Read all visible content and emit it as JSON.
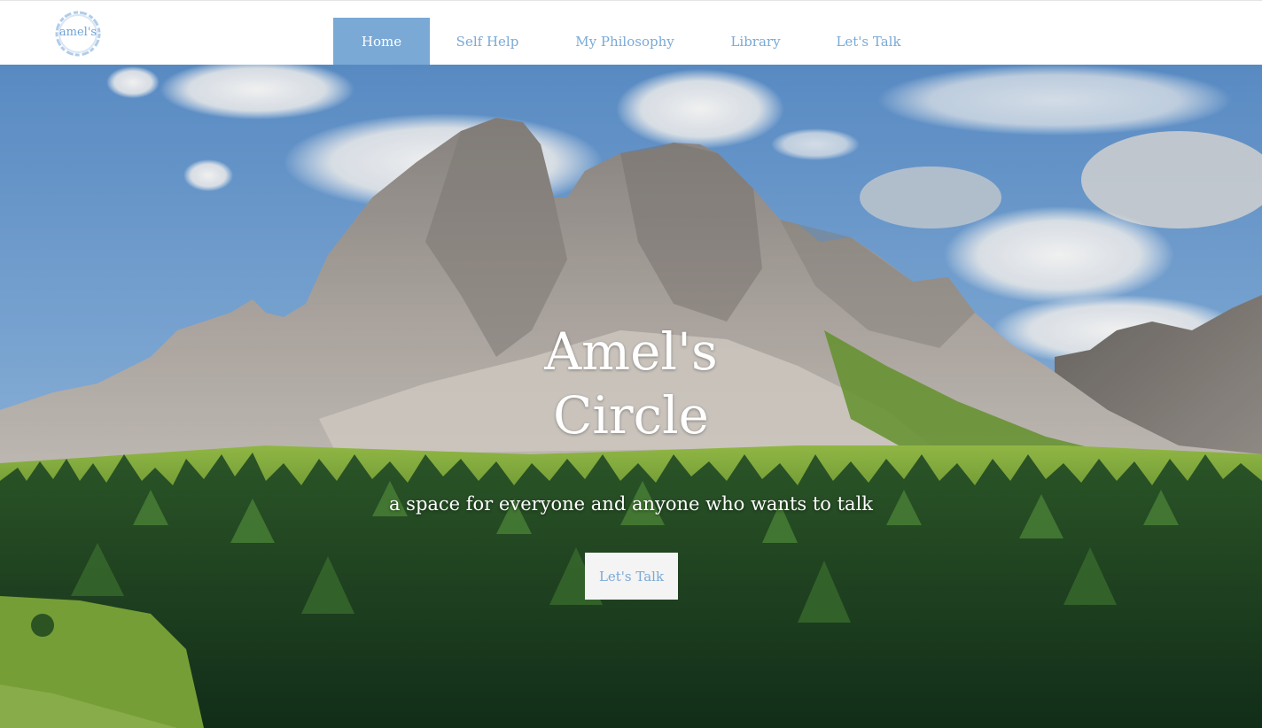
{
  "site": {
    "logo_text": "amel's"
  },
  "nav": {
    "items": [
      {
        "label": "Home",
        "active": true
      },
      {
        "label": "Self Help",
        "active": false
      },
      {
        "label": "My Philosophy",
        "active": false
      },
      {
        "label": "Library",
        "active": false
      },
      {
        "label": "Let's Talk",
        "active": false
      }
    ]
  },
  "hero": {
    "title_line1": "Amel's",
    "title_line2": "Circle",
    "subtitle": "a space for everyone and anyone who wants to talk",
    "cta_label": "Let's Talk"
  },
  "colors": {
    "accent": "#7aa9d6",
    "nav_active_bg": "#7aa9d6",
    "cta_bg": "#f4f4f4"
  }
}
